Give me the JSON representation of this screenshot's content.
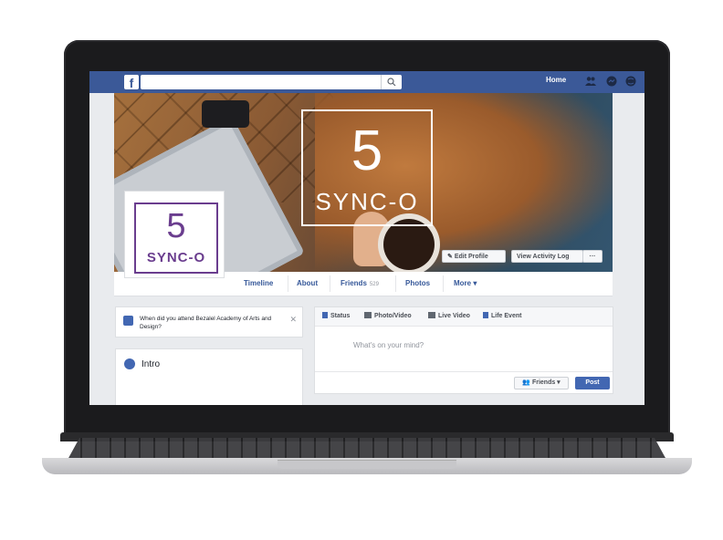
{
  "topbar": {
    "home_label": "Home"
  },
  "cover": {
    "logo_number": "5",
    "logo_text": "SYNC-O",
    "edit_profile_label": "Edit Profile",
    "activity_log_label": "View Activity Log",
    "more_dots": "···"
  },
  "profile_picture": {
    "logo_number": "5",
    "logo_text": "SYNC-O"
  },
  "nav": {
    "tabs": [
      {
        "label": "Timeline"
      },
      {
        "label": "About"
      },
      {
        "label": "Friends",
        "count": "529"
      },
      {
        "label": "Photos"
      },
      {
        "label": "More ▾"
      }
    ]
  },
  "notice": {
    "text": "When did you attend Bezalel Academy of Arts and Design?",
    "close": "✕"
  },
  "intro": {
    "label": "Intro"
  },
  "composer": {
    "tabs": [
      {
        "label": "Status",
        "icon": "pencil-icon"
      },
      {
        "label": "Photo/Video",
        "icon": "camera-icon"
      },
      {
        "label": "Live Video",
        "icon": "video-icon"
      },
      {
        "label": "Life Event",
        "icon": "flag-icon"
      }
    ],
    "placeholder": "What's on your mind?",
    "audience_label": "Friends ▾",
    "post_label": "Post"
  },
  "colors": {
    "facebook_blue": "#3b5998",
    "button_blue": "#4267b2",
    "brand_purple": "#6a3d8e"
  }
}
